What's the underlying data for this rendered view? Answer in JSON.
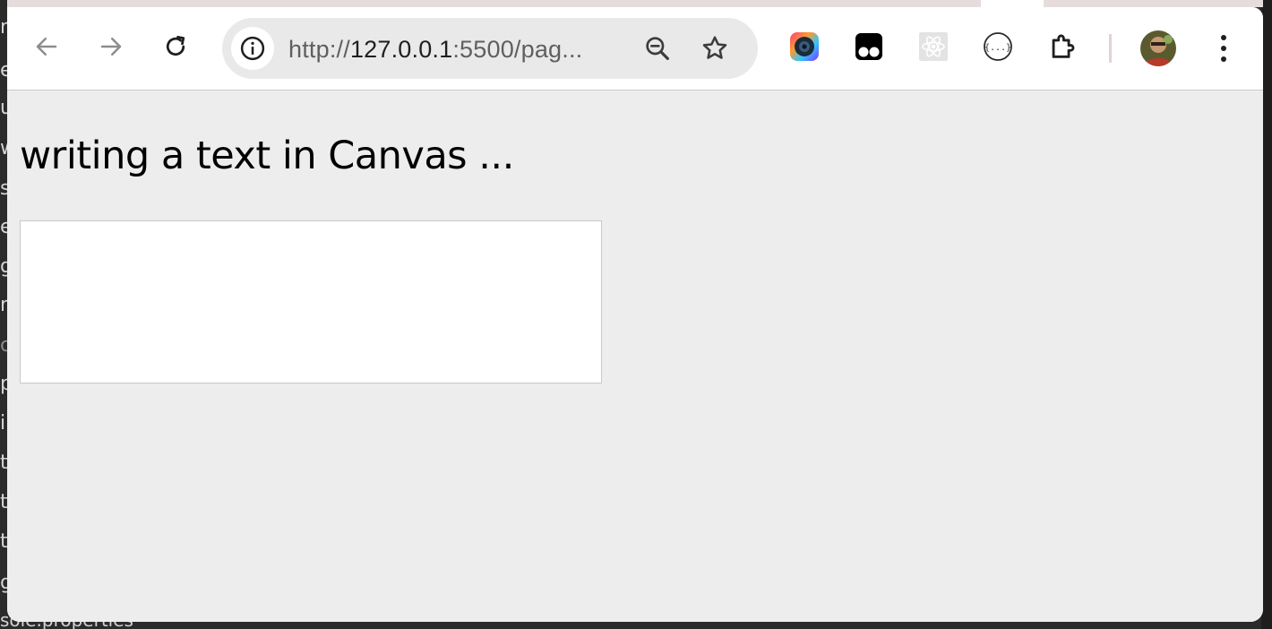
{
  "background": {
    "glyphs": [
      "m",
      "e",
      "u",
      "w",
      "s",
      "e",
      "g",
      "ri",
      "c",
      "p",
      "ir",
      "t",
      "t",
      "t",
      "g"
    ],
    "bottom_text": "sole.properties"
  },
  "browser": {
    "nav": {
      "back_icon": "arrow-left-icon",
      "forward_icon": "arrow-right-icon",
      "reload_icon": "reload-icon"
    },
    "omnibox": {
      "url_prefix": "http://",
      "url_host": "127.0.0.1",
      "url_rest": ":5500/pag..."
    },
    "extensions": [
      "camera-extension-icon",
      "tampermonkey-icon",
      "react-devtools-icon",
      "json-formatter-icon",
      "extensions-puzzle-icon"
    ],
    "colors": {
      "toolbar": "#ffffff",
      "omnibox": "#e9e9e9",
      "page_background": "#ededed"
    }
  },
  "page": {
    "heading": "writing a text in Canvas ..."
  }
}
